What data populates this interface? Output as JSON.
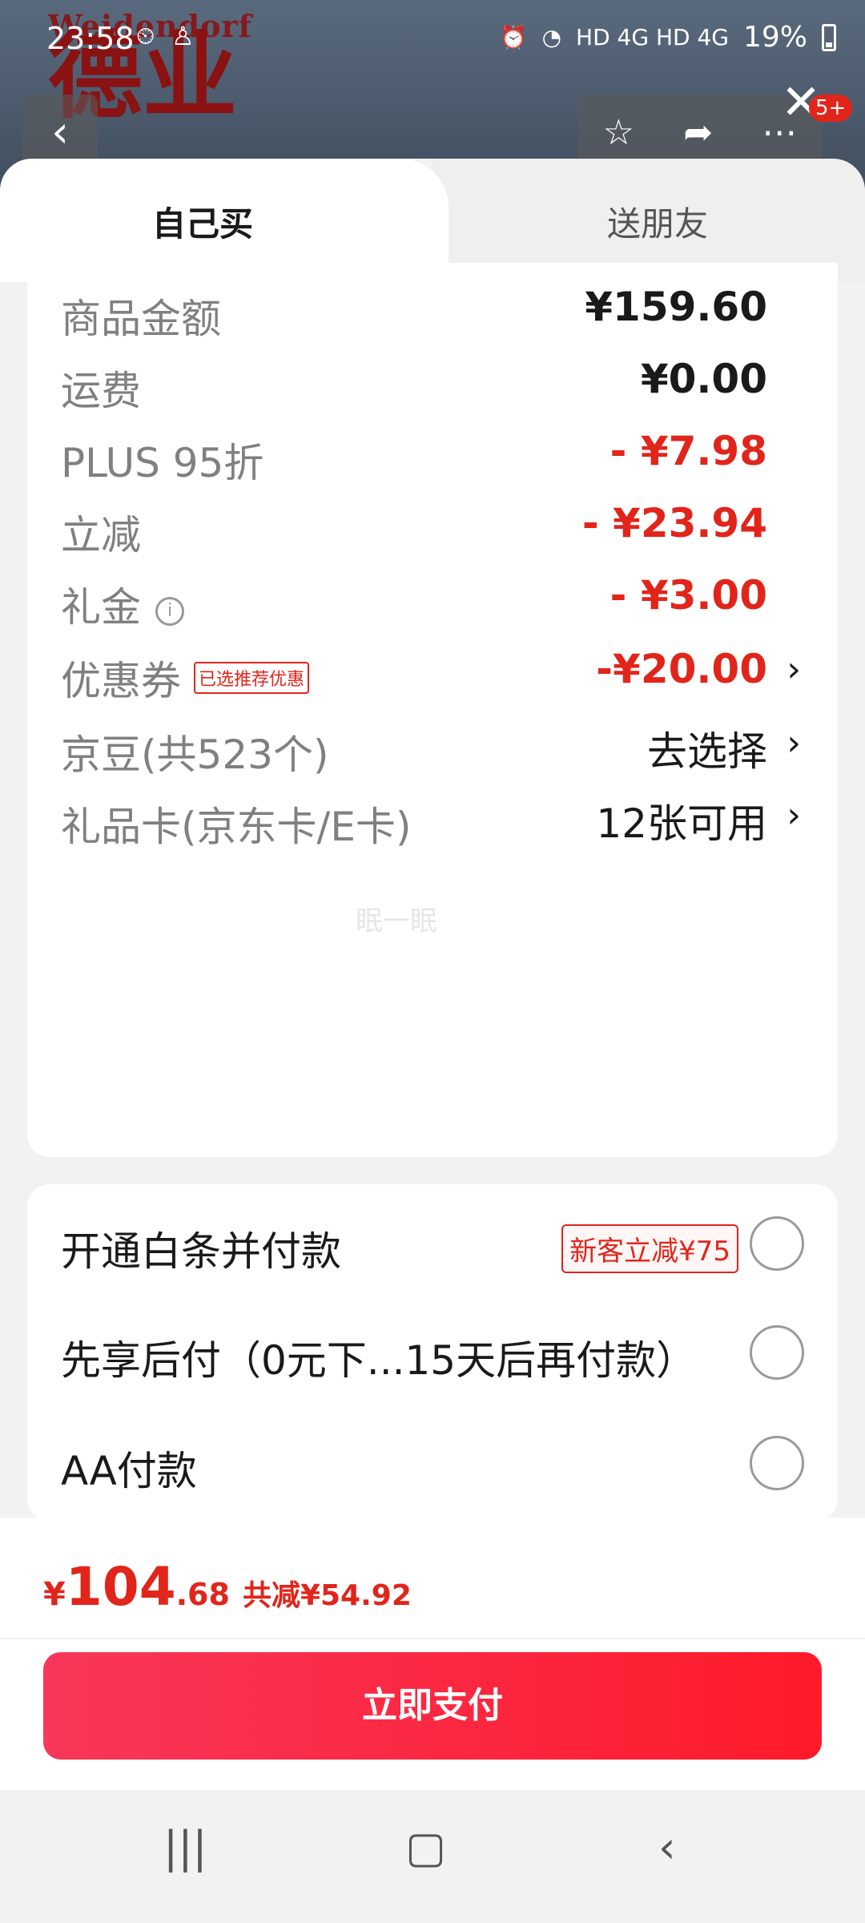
{
  "status_bar": {
    "time": "23:58",
    "network": "HD 4G HD 4G",
    "battery": "19%"
  },
  "background": {
    "brand_latin": "Weidendorf",
    "brand_cjk": "德业"
  },
  "top_actions": {
    "badge": "5+"
  },
  "tabs": [
    {
      "label": "自己买"
    },
    {
      "label": "送朋友"
    }
  ],
  "summary_rows": [
    {
      "label": "商品金额",
      "value": "¥159.60"
    },
    {
      "label": "运费",
      "value": "¥0.00"
    },
    {
      "label": "PLUS 95折",
      "value": "- ¥7.98"
    },
    {
      "label": "立减",
      "value": "- ¥23.94"
    },
    {
      "label": "礼金",
      "value": "- ¥3.00"
    },
    {
      "label": "优惠券",
      "tag": "已选推荐优惠",
      "value": "-¥20.00"
    },
    {
      "label": "京豆(共523个)",
      "value": "去选择"
    },
    {
      "label": "礼品卡(京东卡/E卡)",
      "value": "12张可用"
    }
  ],
  "watermark": "眠一眠",
  "payment_options": [
    {
      "label": "开通白条并付款",
      "tag": "新客立减¥75"
    },
    {
      "label": "先享后付（0元下...15天后再付款）"
    },
    {
      "label": "AA付款"
    }
  ],
  "footer": {
    "currency": "¥",
    "total_int": "104",
    "total_dec": ".68",
    "saved": "共减¥54.92",
    "pay_button": "立即支付"
  },
  "colors": {
    "accent_red": "#e1251b",
    "button_gradient_start": "#f8375a",
    "button_gradient_end": "#ff1a2a"
  }
}
